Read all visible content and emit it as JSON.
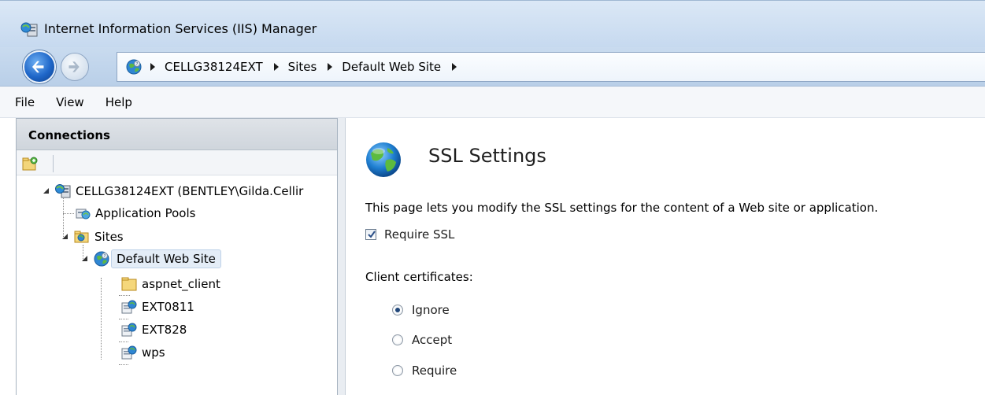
{
  "window": {
    "title": "Internet Information Services (IIS) Manager"
  },
  "address_bar": {
    "breadcrumbs": [
      "CELLG38124EXT",
      "Sites",
      "Default Web Site"
    ]
  },
  "menu": [
    "File",
    "View",
    "Help"
  ],
  "connections": {
    "header": "Connections",
    "tree": {
      "server": "CELLG38124EXT (BENTLEY\\Gilda.Cellir",
      "app_pools": "Application Pools",
      "sites": "Sites",
      "default_site": "Default Web Site",
      "children": [
        "aspnet_client",
        "EXT0811",
        "EXT828",
        "wps"
      ]
    }
  },
  "content": {
    "title": "SSL Settings",
    "description": "This page lets you modify the SSL settings for the content of a Web site or application.",
    "require_ssl_label": "Require SSL",
    "require_ssl_checked": true,
    "client_certificates_label": "Client certificates:",
    "client_certificate_options": [
      "Ignore",
      "Accept",
      "Require"
    ],
    "client_certificate_selected": "Ignore"
  },
  "icons": {
    "app": "iis-manager-icon",
    "address": "globe-icon",
    "connect": "connect-icon",
    "server": "server-icon",
    "app_pools": "application-pools-icon",
    "sites": "sites-folder-icon",
    "site": "website-globe-icon",
    "folder": "folder-icon",
    "application": "application-icon",
    "feature": "ssl-globe-icon"
  },
  "colors": {
    "titlebar": "#c6d9ef",
    "selection": "#e4edf7",
    "radio_dot": "#21477a"
  }
}
